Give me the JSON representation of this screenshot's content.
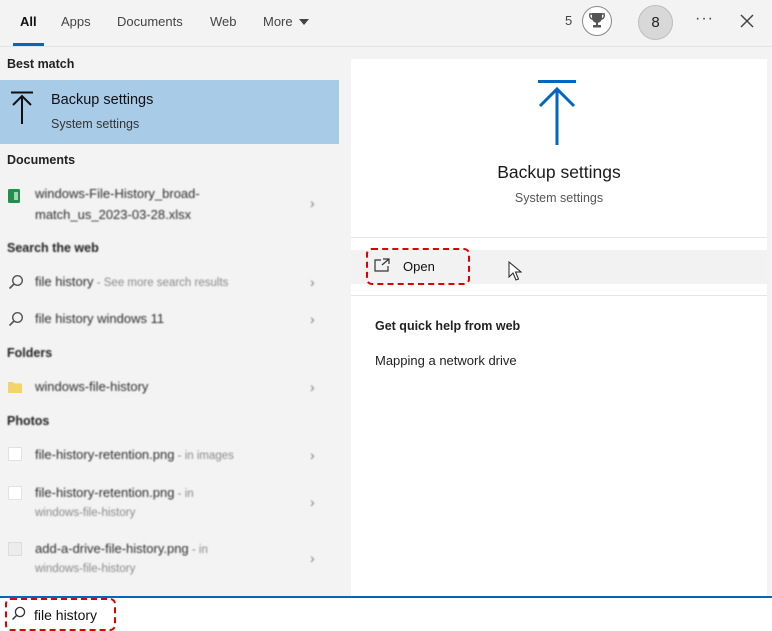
{
  "tabs": [
    {
      "label": "All",
      "active": true
    },
    {
      "label": "Apps",
      "active": false
    },
    {
      "label": "Documents",
      "active": false
    },
    {
      "label": "Web",
      "active": false
    },
    {
      "label": "More",
      "active": false,
      "dropdown": true
    }
  ],
  "header": {
    "points": "5",
    "avatar_initial": "8",
    "more_options": "···"
  },
  "best_match": {
    "section_label": "Best match",
    "title": "Backup settings",
    "subtitle": "System settings",
    "icon": "backup-arrow-icon"
  },
  "documents": {
    "section_label": "Documents",
    "items": [
      {
        "line1": "windows-File-History_broad-",
        "line2": "match_us_2023-03-28.xlsx",
        "icon": "excel-file-icon"
      }
    ]
  },
  "web": {
    "section_label": "Search the web",
    "items": [
      {
        "text": "file history",
        "hint": " - See more search results"
      },
      {
        "text": "file history windows 11",
        "hint": ""
      }
    ]
  },
  "folders": {
    "section_label": "Folders",
    "items": [
      {
        "text": "windows-file-history",
        "icon": "folder-icon"
      }
    ]
  },
  "photos": {
    "section_label": "Photos",
    "items": [
      {
        "text": "file-history-retention.png",
        "hint": " - in images",
        "line2": ""
      },
      {
        "text": "file-history-retention.png",
        "hint": " - in",
        "line2": "windows-file-history"
      },
      {
        "text": "add-a-drive-file-history.png",
        "hint": " - in",
        "line2": "windows-file-history"
      }
    ]
  },
  "detail": {
    "title": "Backup settings",
    "subtitle": "System settings",
    "open_label": "Open",
    "help_title": "Get quick help from web",
    "help_links": [
      "Mapping a network drive"
    ]
  },
  "search": {
    "value": "file history"
  },
  "colors": {
    "accent": "#0067c0",
    "selection": "#a8cbe8",
    "highlight": "#e00000"
  }
}
